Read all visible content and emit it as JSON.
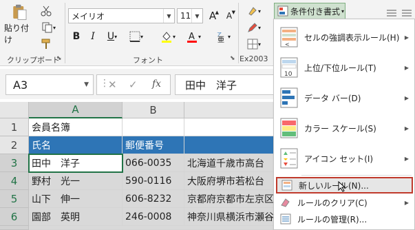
{
  "ribbon": {
    "clipboard": {
      "paste_label": "貼り付け",
      "group_label": "クリップボード"
    },
    "font": {
      "font_name": "メイリオ",
      "font_size": "11",
      "bold": "B",
      "italic": "I",
      "underline": "U",
      "grow": "A",
      "shrink": "A",
      "group_label": "フォント"
    },
    "ex2003": {
      "group_label": "Ex2003"
    },
    "cond_format_label": "条件付き書式"
  },
  "formula_bar": {
    "name_box": "A3",
    "fx": "fx",
    "formula": "田中　洋子"
  },
  "sheet": {
    "columns": [
      "A",
      "B"
    ],
    "rows": [
      "1",
      "2",
      "3",
      "4",
      "5",
      "6"
    ],
    "cells": {
      "r1": [
        "会員名簿",
        "",
        ""
      ],
      "r2": [
        "氏名",
        "郵便番号",
        ""
      ],
      "r3": [
        "田中　洋子",
        "066-0035",
        "北海道千歳市高台"
      ],
      "r4": [
        "野村　光一",
        "590-0116",
        "大阪府堺市若松台"
      ],
      "r5": [
        "山下　伸一",
        "606-8232",
        "京都府京都市左京区"
      ],
      "r6": [
        "園部　英明",
        "246-0008",
        "神奈川県横浜市瀬谷"
      ]
    }
  },
  "menu": {
    "items": [
      {
        "label": "セルの強調表示ルール(H)",
        "icon": "highlight-cells-icon"
      },
      {
        "label": "上位/下位ルール(T)",
        "icon": "top-bottom-icon"
      },
      {
        "label": "データ バー(D)",
        "icon": "data-bars-icon"
      },
      {
        "label": "カラー スケール(S)",
        "icon": "color-scales-icon"
      },
      {
        "label": "アイコン セット(I)",
        "icon": "icon-sets-icon"
      }
    ],
    "new_rule": "新しいルール(N)...",
    "clear_rules": "ルールのクリア(C)",
    "manage_rules": "ルールの管理(R)..."
  },
  "colors": {
    "header_blue": "#2e75b6",
    "highlight_red": "#c0392b",
    "accent_green": "#217346"
  }
}
